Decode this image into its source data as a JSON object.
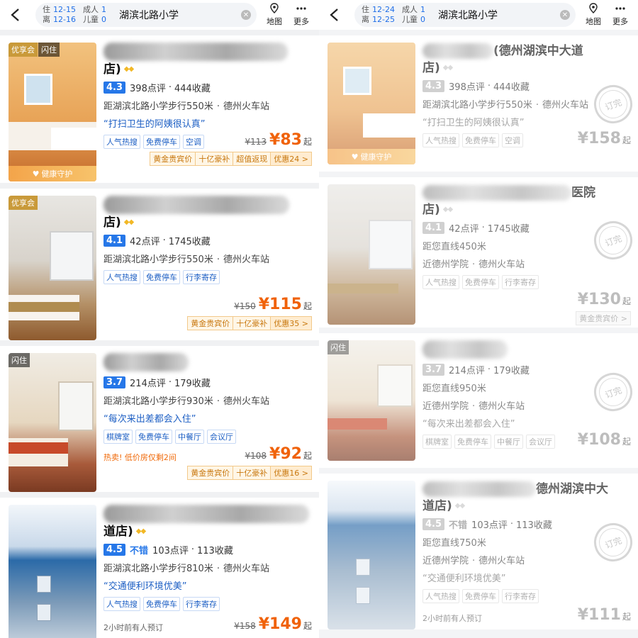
{
  "left": {
    "header": {
      "checkin_label": "住",
      "checkin": "12-15",
      "checkout_label": "离",
      "checkout": "12-16",
      "adults_label": "成人",
      "adults": "1",
      "children_label": "儿童",
      "children": "0",
      "keyword": "湖滨北路小学",
      "map": "地图",
      "more": "更多"
    },
    "hotels": [
      {
        "tags": [
          "优享会",
          "闪住"
        ],
        "name_visible": "店)",
        "score": "4.3",
        "reviews": "398点评",
        "favorites": "444收藏",
        "distance": "距湖滨北路小学步行550米",
        "landmark": "德州火车站",
        "quote": "“打扫卫生的阿姨很认真”",
        "chips": [
          "人气热搜",
          "免费停车",
          "空调"
        ],
        "old_price": "¥113",
        "price": "¥83",
        "price_suffix": "起",
        "promos": [
          "黄金贵宾价",
          "十亿豪补",
          "超值返现",
          "优惠24 >"
        ],
        "photo_badge": "健康守护"
      },
      {
        "tags": [
          "优享会"
        ],
        "name_visible": "店)",
        "score": "4.1",
        "reviews": "42点评",
        "favorites": "1745收藏",
        "distance": "距湖滨北路小学步行550米",
        "landmark": "德州火车站",
        "chips": [
          "人气热搜",
          "免费停车",
          "行李寄存"
        ],
        "old_price": "¥150",
        "price": "¥115",
        "price_suffix": "起",
        "promos": [
          "黄金贵宾价",
          "十亿豪补",
          "优惠35 >"
        ]
      },
      {
        "tags": [
          "闪住"
        ],
        "score": "3.7",
        "reviews": "214点评",
        "favorites": "179收藏",
        "distance": "距湖滨北路小学步行930米",
        "landmark": "德州火车站",
        "quote": "“每次来出差都会入住”",
        "chips": [
          "棋牌室",
          "免费停车",
          "中餐厅",
          "会议厅"
        ],
        "hot": "热卖! 低价房仅剩2间",
        "old_price": "¥108",
        "price": "¥92",
        "price_suffix": "起",
        "promos": [
          "黄金贵宾价",
          "十亿豪补",
          "优惠16 >"
        ]
      },
      {
        "name_visible": "道店)",
        "score": "4.5",
        "good": "不错",
        "reviews": "103点评",
        "favorites": "113收藏",
        "distance": "距湖滨北路小学步行810米",
        "landmark": "德州火车站",
        "quote": "“交通便利环境优美”",
        "chips": [
          "人气热搜",
          "免费停车",
          "行李寄存"
        ],
        "booked": "2小时前有人预订",
        "old_price": "¥158",
        "price": "¥149",
        "price_suffix": "起"
      }
    ]
  },
  "right": {
    "header": {
      "checkin_label": "住",
      "checkin": "12-24",
      "checkout_label": "离",
      "checkout": "12-25",
      "adults_label": "成人",
      "adults": "1",
      "children_label": "儿童",
      "children": "0",
      "keyword": "湖滨北路小学",
      "map": "地图",
      "more": "更多"
    },
    "hotels": [
      {
        "name_visible": "(德州湖滨中大道",
        "name_line2": "店)",
        "score": "4.3",
        "reviews": "398点评",
        "favorites": "444收藏",
        "distance": "距湖滨北路小学步行550米",
        "landmark": "德州火车站",
        "quote": "“打扫卫生的阿姨很认真”",
        "chips": [
          "人气热搜",
          "免费停车",
          "空调"
        ],
        "price": "¥158",
        "price_suffix": "起",
        "stamp": "订完",
        "photo_badge": "健康守护"
      },
      {
        "name_visible": "医院",
        "name_line2": "店)",
        "score": "4.1",
        "reviews": "42点评",
        "favorites": "1745收藏",
        "distance": "距您直线450米",
        "near": "近德州学院",
        "landmark": "德州火车站",
        "chips": [
          "人气热搜",
          "免费停车",
          "行李寄存"
        ],
        "price": "¥130",
        "price_suffix": "起",
        "promo": "黄金贵宾价 >",
        "stamp": "订完"
      },
      {
        "tags": [
          "闪住"
        ],
        "score": "3.7",
        "reviews": "214点评",
        "favorites": "179收藏",
        "distance": "距您直线950米",
        "near": "近德州学院",
        "landmark": "德州火车站",
        "quote": "“每次来出差都会入住”",
        "chips": [
          "棋牌室",
          "免费停车",
          "中餐厅",
          "会议厅"
        ],
        "price": "¥108",
        "price_suffix": "起",
        "stamp": "订完"
      },
      {
        "name_visible": "德州湖滨中大",
        "name_line2": "道店)",
        "score": "4.5",
        "good": "不错",
        "reviews": "103点评",
        "favorites": "113收藏",
        "distance": "距您直线750米",
        "near": "近德州学院",
        "landmark": "德州火车站",
        "quote": "“交通便利环境优美”",
        "chips": [
          "人气热搜",
          "免费停车",
          "行李寄存"
        ],
        "booked": "2小时前有人预订",
        "price": "¥111",
        "price_suffix": "起",
        "stamp": "订完"
      }
    ]
  },
  "colors": {
    "accent": "#2677e8",
    "price": "#f0620a",
    "promo": "#c8780f"
  }
}
